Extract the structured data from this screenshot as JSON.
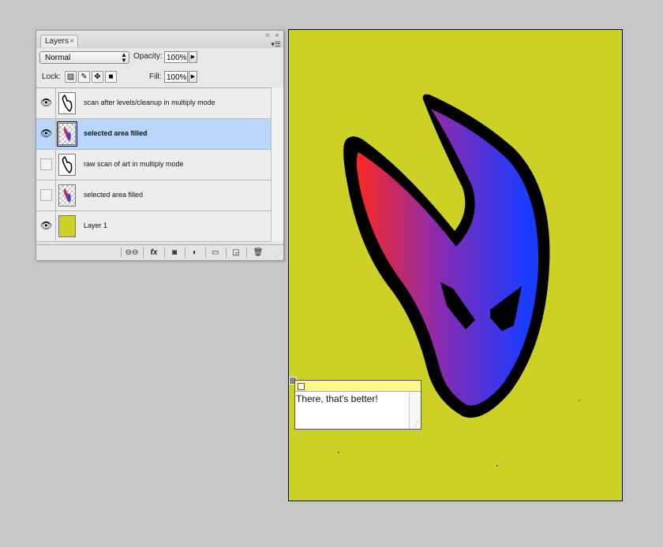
{
  "panel": {
    "tab_label": "Layers",
    "tab_close": "×",
    "minimize": "=",
    "close": "×",
    "menu_icon": "▾☰"
  },
  "controls": {
    "blend_mode": "Normal",
    "opacity_label": "Opacity:",
    "opacity_value": "100%",
    "lock_label": "Lock:",
    "fill_label": "Fill:",
    "fill_value": "100%"
  },
  "layers": [
    {
      "name": "scan after levels/cleanup in multiply mode",
      "visible": true,
      "selected": false,
      "thumb": "art-white"
    },
    {
      "name": "selected area filled",
      "visible": true,
      "selected": true,
      "thumb": "gradient-checker"
    },
    {
      "name": "raw scan of art in multiply mode",
      "visible": false,
      "selected": false,
      "thumb": "art-white"
    },
    {
      "name": "selected area filled",
      "visible": false,
      "selected": false,
      "thumb": "gradient-checker"
    },
    {
      "name": "Layer 1",
      "visible": true,
      "selected": false,
      "thumb": "solid-yellow"
    }
  ],
  "bottom_icons": [
    "link-icon",
    "fx-icon",
    "mask-icon",
    "adjustment-icon",
    "folder-icon",
    "new-layer-icon",
    "trash-icon"
  ],
  "note": {
    "text": "There, that's better!"
  },
  "colors": {
    "canvas": "#ced125",
    "selected_row": "#b9d7fb",
    "gradient_start": "#ff2a1a",
    "gradient_mid": "#7e2bb5",
    "gradient_end": "#1a3cff"
  }
}
